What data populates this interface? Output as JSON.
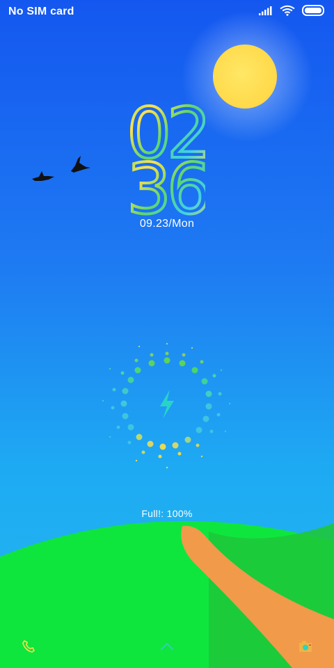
{
  "status_bar": {
    "carrier": "No SIM card",
    "icons": [
      "signal-icon",
      "wifi-icon",
      "battery-icon"
    ]
  },
  "clock": {
    "hour": "02",
    "minute": "36"
  },
  "date": "09.23/Mon",
  "battery_status": "Full!: 100%",
  "colors": {
    "sky_top": "#1457f0",
    "sky_bottom": "#22b9ee",
    "sun": "#ffd949",
    "grass": "#0ee63e",
    "path": "#f09a4a",
    "bolt": "#29d3c7"
  },
  "dock": {
    "left_icon": "phone-icon",
    "center_icon": "chevron-up-icon",
    "right_icon": "camera-icon"
  }
}
